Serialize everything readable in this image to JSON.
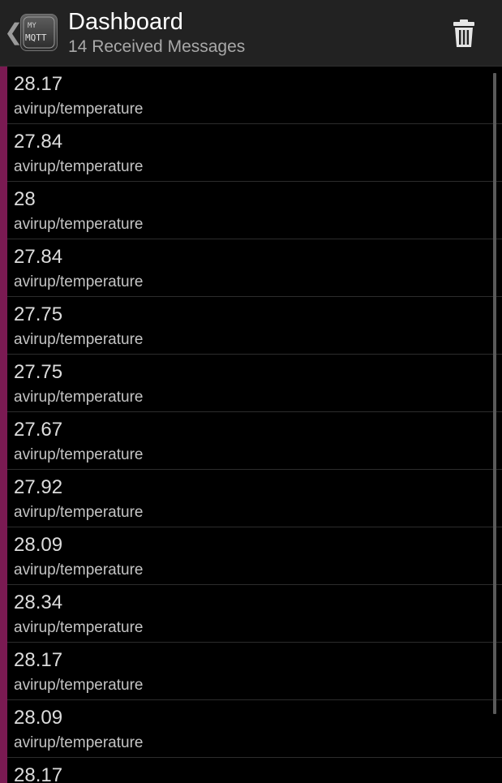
{
  "header": {
    "title": "Dashboard",
    "subtitle": "14 Received Messages",
    "logo_text_top": "MY",
    "logo_text_bottom": "MQTT",
    "back_glyph": "❮",
    "back_icon": "chevron-left-icon",
    "delete_icon": "trash-icon"
  },
  "colors": {
    "action_bar": "#222222",
    "accent": "#7a1a52",
    "background": "#000000",
    "divider": "#2c2c2c"
  },
  "messages": [
    {
      "payload": "28.17",
      "topic": "avirup/temperature"
    },
    {
      "payload": "27.84",
      "topic": "avirup/temperature"
    },
    {
      "payload": "28",
      "topic": "avirup/temperature"
    },
    {
      "payload": "27.84",
      "topic": "avirup/temperature"
    },
    {
      "payload": "27.75",
      "topic": "avirup/temperature"
    },
    {
      "payload": "27.75",
      "topic": "avirup/temperature"
    },
    {
      "payload": "27.67",
      "topic": "avirup/temperature"
    },
    {
      "payload": "27.92",
      "topic": "avirup/temperature"
    },
    {
      "payload": "28.09",
      "topic": "avirup/temperature"
    },
    {
      "payload": "28.34",
      "topic": "avirup/temperature"
    },
    {
      "payload": "28.17",
      "topic": "avirup/temperature"
    },
    {
      "payload": "28.09",
      "topic": "avirup/temperature"
    },
    {
      "payload": "28.17",
      "topic": ""
    }
  ]
}
